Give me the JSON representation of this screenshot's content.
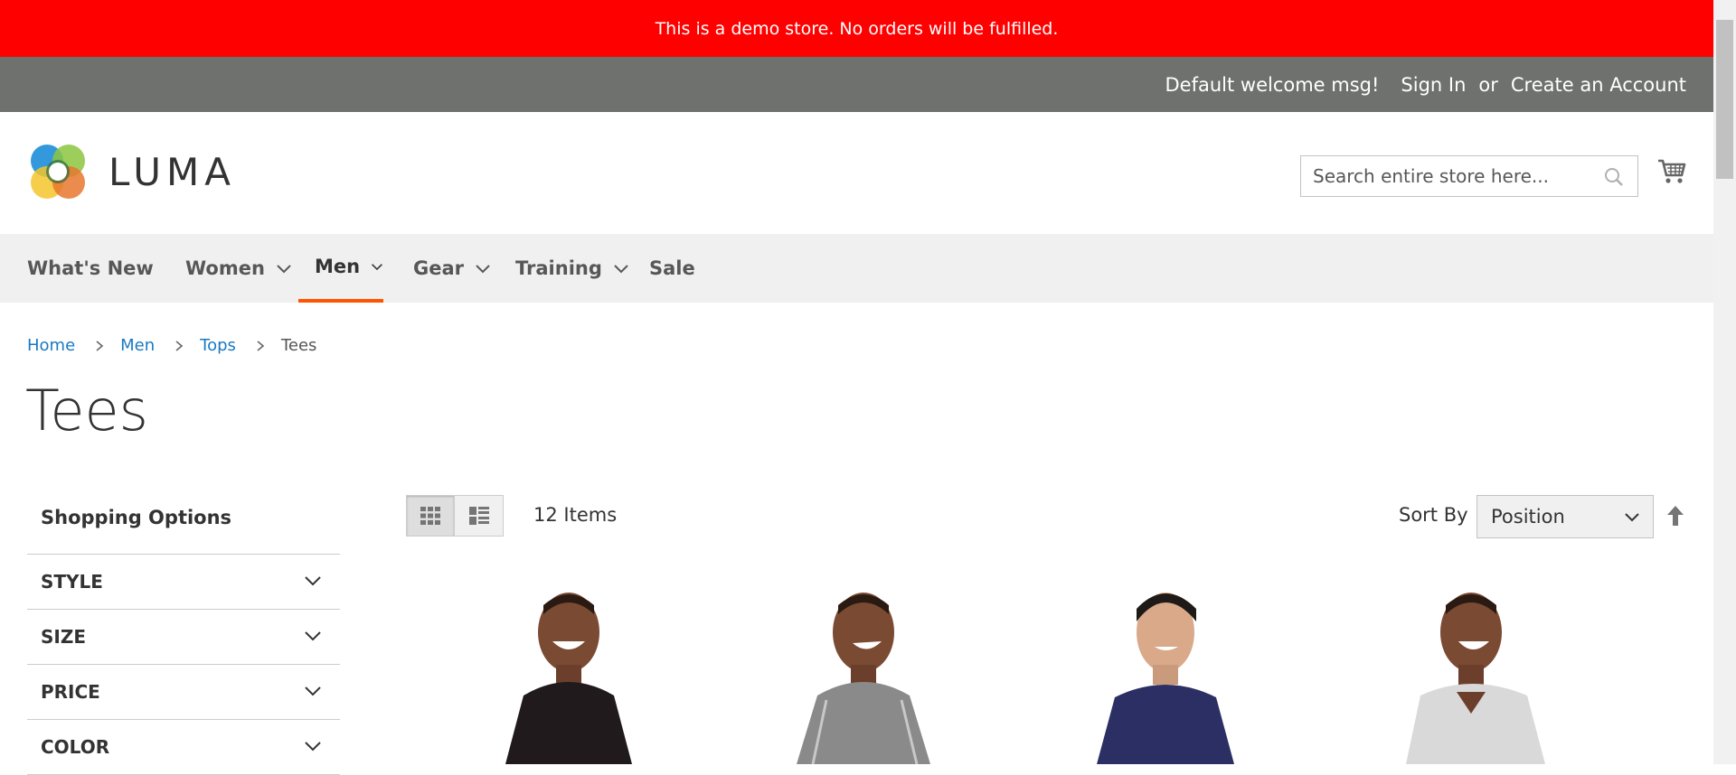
{
  "demo_notice": "This is a demo store. No orders will be fulfilled.",
  "header_links": {
    "welcome": "Default welcome msg!",
    "sign_in": "Sign In",
    "or": "or",
    "create_account": "Create an Account"
  },
  "logo": {
    "text": "LUMA"
  },
  "search": {
    "placeholder": "Search entire store here..."
  },
  "nav": {
    "items": [
      {
        "label": "What's New",
        "has_dropdown": false
      },
      {
        "label": "Women",
        "has_dropdown": true
      },
      {
        "label": "Men",
        "has_dropdown": true,
        "active": true
      },
      {
        "label": "Gear",
        "has_dropdown": true
      },
      {
        "label": "Training",
        "has_dropdown": true
      },
      {
        "label": "Sale",
        "has_dropdown": false
      }
    ]
  },
  "breadcrumbs": {
    "items": [
      "Home",
      "Men",
      "Tops"
    ],
    "current": "Tees"
  },
  "page_title": "Tees",
  "sidebar": {
    "title": "Shopping Options",
    "filters": [
      "STYLE",
      "SIZE",
      "PRICE",
      "COLOR"
    ]
  },
  "toolbar": {
    "amount": "12 Items",
    "sort_label": "Sort By",
    "sort_value": "Position"
  },
  "products": [
    {
      "shirt_color": "#201a1c"
    },
    {
      "shirt_color": "#8a8a8a"
    },
    {
      "shirt_color": "#2b2f63"
    },
    {
      "shirt_color": "#d9d9d9"
    }
  ],
  "colors": {
    "demo_bar": "#ff0000",
    "welcome_bar": "#6e716e",
    "nav_bg": "#f0f0f0",
    "nav_active": "#ff5501",
    "link": "#1979c3"
  }
}
